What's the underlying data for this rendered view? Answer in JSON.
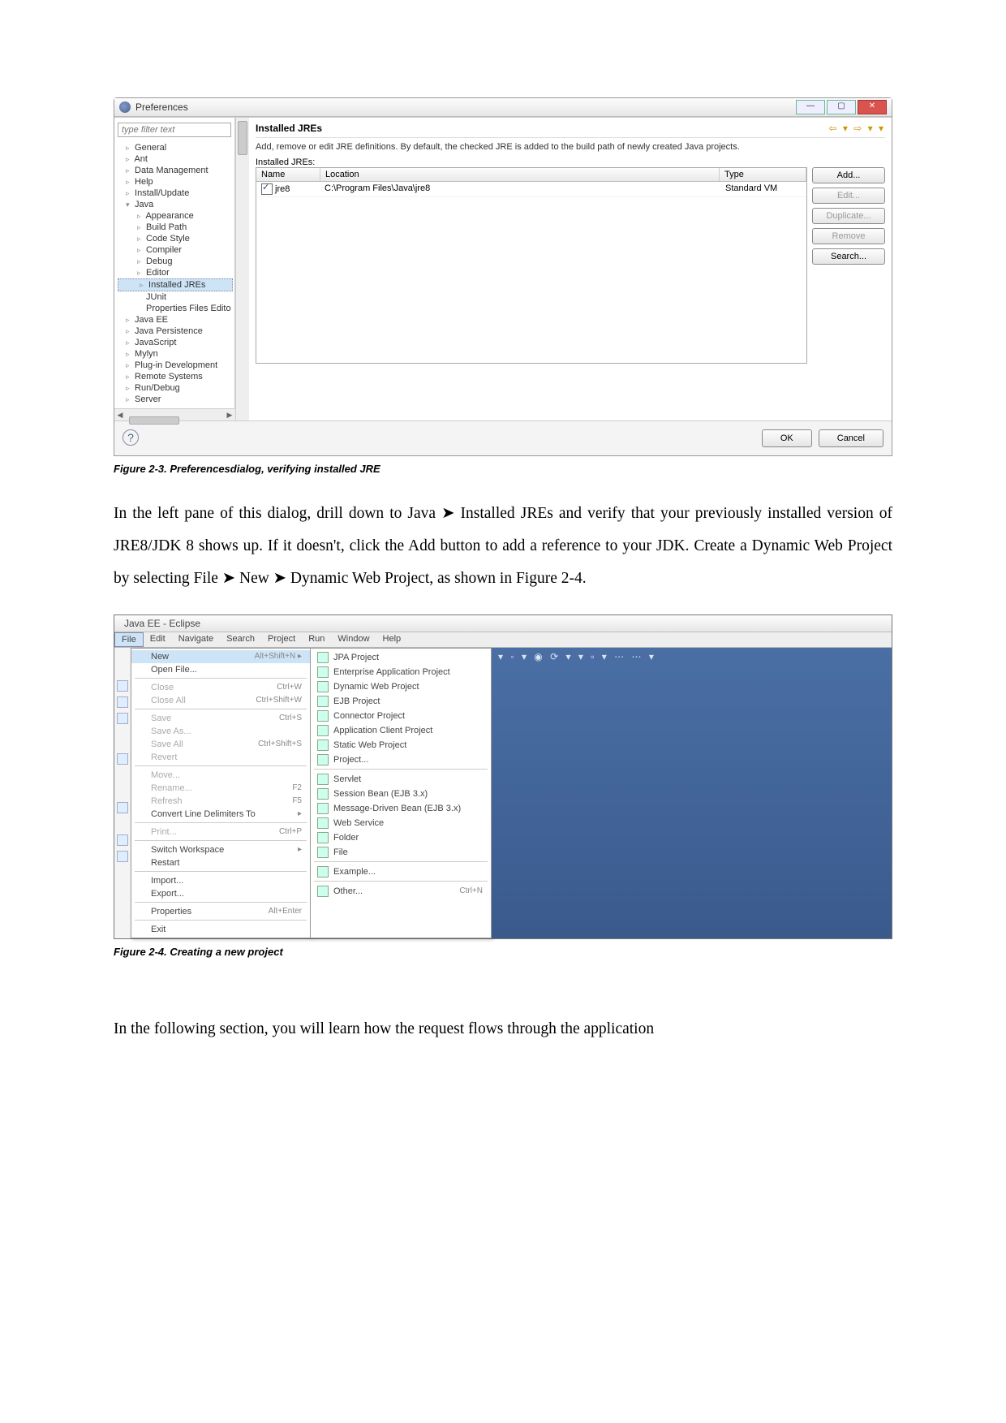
{
  "preferences": {
    "window_title": "Preferences",
    "filter_placeholder": "type filter text",
    "tree": [
      {
        "label": "General",
        "lvl": 0,
        "arrow": "▹"
      },
      {
        "label": "Ant",
        "lvl": 0,
        "arrow": "▹"
      },
      {
        "label": "Data Management",
        "lvl": 0,
        "arrow": "▹"
      },
      {
        "label": "Help",
        "lvl": 0,
        "arrow": "▹"
      },
      {
        "label": "Install/Update",
        "lvl": 0,
        "arrow": "▹"
      },
      {
        "label": "Java",
        "lvl": 0,
        "arrow": "▾"
      },
      {
        "label": "Appearance",
        "lvl": 1,
        "arrow": "▹"
      },
      {
        "label": "Build Path",
        "lvl": 1,
        "arrow": "▹"
      },
      {
        "label": "Code Style",
        "lvl": 1,
        "arrow": "▹"
      },
      {
        "label": "Compiler",
        "lvl": 1,
        "arrow": "▹"
      },
      {
        "label": "Debug",
        "lvl": 1,
        "arrow": "▹"
      },
      {
        "label": "Editor",
        "lvl": 1,
        "arrow": "▹"
      },
      {
        "label": "Installed JREs",
        "lvl": 1,
        "arrow": "▹",
        "selected": true
      },
      {
        "label": "JUnit",
        "lvl": 1,
        "arrow": ""
      },
      {
        "label": "Properties Files Edito",
        "lvl": 1,
        "arrow": ""
      },
      {
        "label": "Java EE",
        "lvl": 0,
        "arrow": "▹"
      },
      {
        "label": "Java Persistence",
        "lvl": 0,
        "arrow": "▹"
      },
      {
        "label": "JavaScript",
        "lvl": 0,
        "arrow": "▹"
      },
      {
        "label": "Mylyn",
        "lvl": 0,
        "arrow": "▹"
      },
      {
        "label": "Plug-in Development",
        "lvl": 0,
        "arrow": "▹"
      },
      {
        "label": "Remote Systems",
        "lvl": 0,
        "arrow": "▹"
      },
      {
        "label": "Run/Debug",
        "lvl": 0,
        "arrow": "▹"
      },
      {
        "label": "Server",
        "lvl": 0,
        "arrow": "▹"
      }
    ],
    "heading": "Installed JREs",
    "description": "Add, remove or edit JRE definitions. By default, the checked JRE is added to the build path of newly created Java projects.",
    "sublabel": "Installed JREs:",
    "columns": {
      "name": "Name",
      "location": "Location",
      "type": "Type"
    },
    "rows": [
      {
        "checked": true,
        "name": "jre8",
        "location": "C:\\Program Files\\Java\\jre8",
        "type": "Standard VM"
      }
    ],
    "buttons": {
      "add": "Add...",
      "edit": "Edit...",
      "duplicate": "Duplicate...",
      "remove": "Remove",
      "search": "Search..."
    },
    "footer": {
      "ok": "OK",
      "cancel": "Cancel"
    }
  },
  "caption1": "Figure 2-3.  Preferencesdialog, verifying installed JRE",
  "para1": "In the left pane of this dialog, drill down to Java ➤ Installed JREs and verify that your previously installed version of JRE8/JDK 8 shows up. If it doesn't, click the Add button to add a reference to your JDK. Create a Dynamic Web Project by selecting File ➤ New ➤ Dynamic Web Project, as shown in Figure 2-4.",
  "eclipse": {
    "title": "Java EE - Eclipse",
    "menubar": [
      "File",
      "Edit",
      "Navigate",
      "Search",
      "Project",
      "Run",
      "Window",
      "Help"
    ],
    "filemenu": [
      {
        "label": "New",
        "shortcut": "Alt+Shift+N ▸",
        "hl": true
      },
      {
        "label": "Open File..."
      },
      {
        "sep": true
      },
      {
        "label": "Close",
        "shortcut": "Ctrl+W",
        "dim": true
      },
      {
        "label": "Close All",
        "shortcut": "Ctrl+Shift+W",
        "dim": true
      },
      {
        "sep": true
      },
      {
        "label": "Save",
        "shortcut": "Ctrl+S",
        "dim": true
      },
      {
        "label": "Save As...",
        "dim": true
      },
      {
        "label": "Save All",
        "shortcut": "Ctrl+Shift+S",
        "dim": true
      },
      {
        "label": "Revert",
        "dim": true
      },
      {
        "sep": true
      },
      {
        "label": "Move...",
        "dim": true
      },
      {
        "label": "Rename...",
        "shortcut": "F2",
        "dim": true
      },
      {
        "label": "Refresh",
        "shortcut": "F5",
        "dim": true
      },
      {
        "label": "Convert Line Delimiters To",
        "shortcut": "▸"
      },
      {
        "sep": true
      },
      {
        "label": "Print...",
        "shortcut": "Ctrl+P",
        "dim": true
      },
      {
        "sep": true
      },
      {
        "label": "Switch Workspace",
        "shortcut": "▸"
      },
      {
        "label": "Restart"
      },
      {
        "sep": true
      },
      {
        "label": "Import..."
      },
      {
        "label": "Export..."
      },
      {
        "sep": true
      },
      {
        "label": "Properties",
        "shortcut": "Alt+Enter"
      },
      {
        "sep": true
      },
      {
        "label": "Exit"
      }
    ],
    "newmenu": [
      {
        "label": "JPA Project"
      },
      {
        "label": "Enterprise Application Project"
      },
      {
        "label": "Dynamic Web Project"
      },
      {
        "label": "EJB Project"
      },
      {
        "label": "Connector Project"
      },
      {
        "label": "Application Client Project"
      },
      {
        "label": "Static Web Project"
      },
      {
        "label": "Project..."
      },
      {
        "sep": true
      },
      {
        "label": "Servlet"
      },
      {
        "label": "Session Bean (EJB 3.x)"
      },
      {
        "label": "Message-Driven Bean (EJB 3.x)"
      },
      {
        "label": "Web Service"
      },
      {
        "label": "Folder"
      },
      {
        "label": "File"
      },
      {
        "sep": true
      },
      {
        "label": "Example..."
      },
      {
        "sep": true
      },
      {
        "label": "Other...",
        "shortcut": "Ctrl+N"
      }
    ]
  },
  "caption2": "Figure 2-4.  Creating a new project",
  "para2": "In the following section, you will learn how the request flows through the application"
}
